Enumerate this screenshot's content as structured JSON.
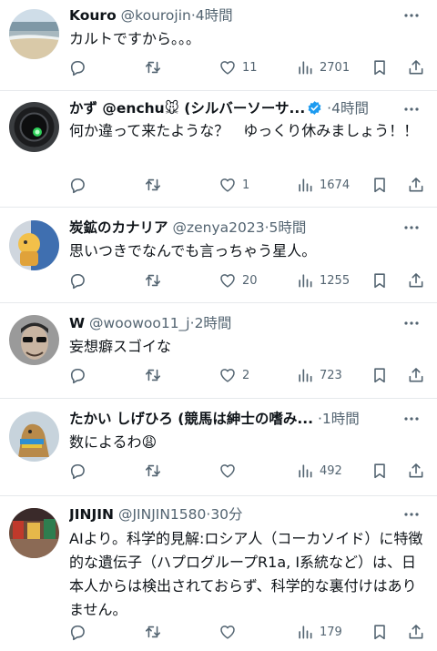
{
  "colors": {
    "text": "#0f1419",
    "muted": "#536471",
    "divider": "#e6e9ec",
    "verified": "#1d9bf0"
  },
  "posts": [
    {
      "display_name": "Kouro",
      "handle": "@kourojin",
      "sep": "·",
      "time": "4時間",
      "text": "カルトですから。。。",
      "avatar": "beach-landscape",
      "verified": false,
      "counts": {
        "replies": "",
        "reposts": "",
        "likes": "11",
        "views": "2701"
      }
    },
    {
      "display_name": "かず @enchu🐭 (シルバーソーサ...",
      "handle": "",
      "sep": "·",
      "time": "4時間",
      "text": "何か違って来たような？　ゆっくり休みましょう！！",
      "avatar": "camera-lens",
      "verified": true,
      "counts": {
        "replies": "",
        "reposts": "",
        "likes": "1",
        "views": "1674"
      }
    },
    {
      "display_name": "炭鉱のカナリア",
      "handle": "@zenya2023",
      "sep": "·",
      "time": "5時間",
      "text": "思いつきでなんでも言っちゃう星人。",
      "avatar": "cartoon-figure",
      "verified": false,
      "counts": {
        "replies": "",
        "reposts": "",
        "likes": "20",
        "views": "1255"
      }
    },
    {
      "display_name": "W",
      "handle": "@woowoo11_j",
      "sep": "·",
      "time": "2時間",
      "text": "妄想癖スゴイな",
      "avatar": "man-sunglasses",
      "verified": false,
      "counts": {
        "replies": "",
        "reposts": "",
        "likes": "2",
        "views": "723"
      }
    },
    {
      "display_name": "たかい しげひろ (競馬は紳士の嗜み...",
      "handle": "",
      "sep": "·",
      "time": "1時間",
      "text": "数によるわ😩",
      "avatar": "camel",
      "verified": false,
      "counts": {
        "replies": "",
        "reposts": "",
        "likes": "",
        "views": "492"
      }
    },
    {
      "display_name": "JINJIN",
      "handle": "@JINJIN1580",
      "sep": "·",
      "time": "30分",
      "text": "AIより。科学的見解:ロシア人（コーカソイド）に特徴的な遺伝子（ハプログループR1a, I系統など）は、日本人からは検出されておらず、科学的な裏付けはありません。",
      "avatar": "market-street",
      "verified": false,
      "counts": {
        "replies": "",
        "reposts": "",
        "likes": "",
        "views": "179"
      }
    }
  ]
}
